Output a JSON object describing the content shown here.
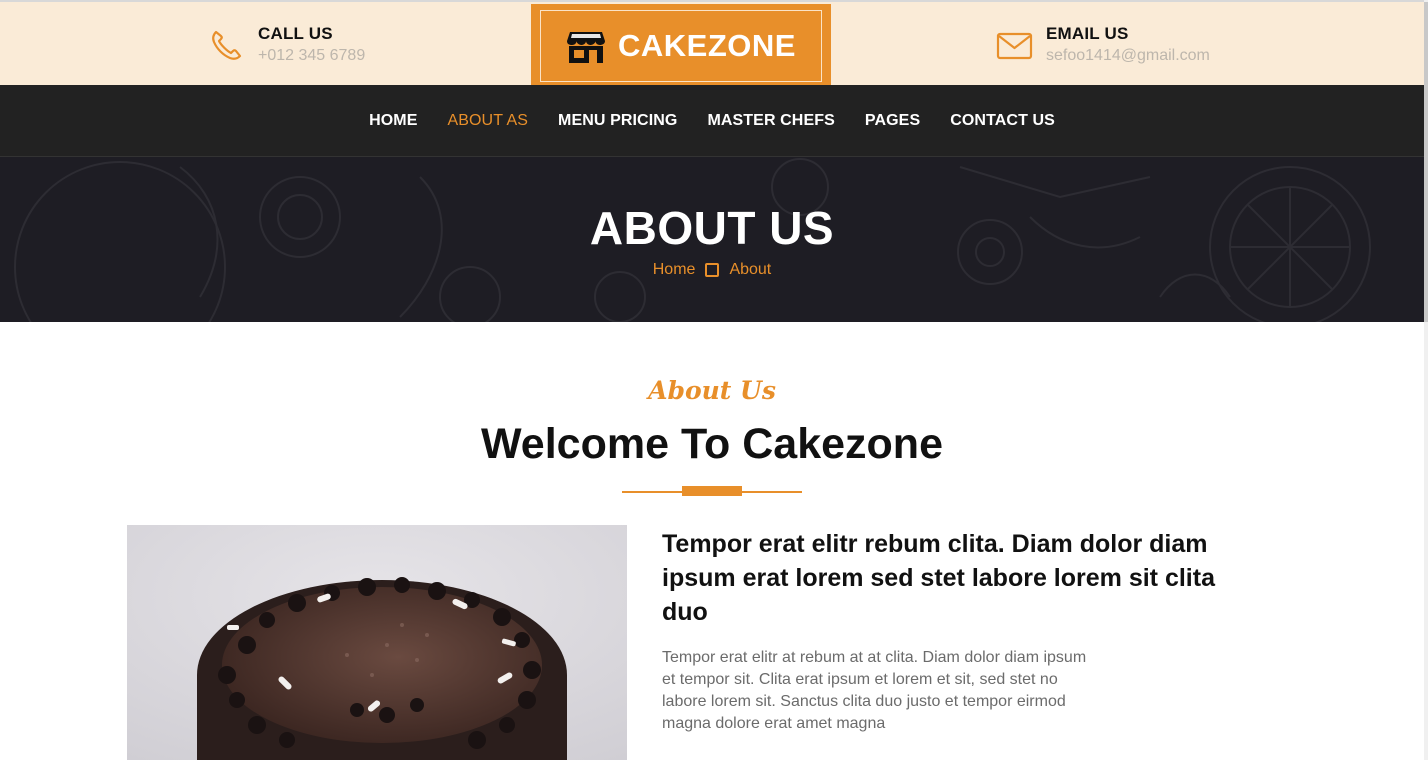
{
  "header": {
    "call": {
      "title": "CALL US",
      "value": "+012 345 6789"
    },
    "email": {
      "title": "EMAIL US",
      "value": "sefoo1414@gmail.com"
    },
    "logo_text": "CAKEZONE"
  },
  "nav": {
    "items": [
      {
        "label": "HOME"
      },
      {
        "label": "ABOUT AS"
      },
      {
        "label": "MENU PRICING"
      },
      {
        "label": "MASTER CHEFS"
      },
      {
        "label": "PAGES"
      },
      {
        "label": "CONTACT US"
      }
    ],
    "active_label": "ABOUT AS"
  },
  "hero": {
    "title": "ABOUT US",
    "breadcrumb": [
      "Home",
      "About"
    ]
  },
  "about": {
    "kicker": "About Us",
    "title": "Welcome To Cakezone",
    "lead": "Tempor erat elitr rebum clita. Diam dolor diam ipsum erat lorem sed stet labore lorem sit clita duo",
    "body": "Tempor erat elitr at rebum at at clita. Diam dolor diam ipsum et tempor sit. Clita erat ipsum et lorem et sit, sed stet no labore lorem sit. Sanctus clita duo justo et tempor eirmod magna dolore erat amet magna"
  },
  "colors": {
    "accent": "#E88F2A",
    "topbar_bg": "#FAEBD7",
    "nav_bg": "#222222",
    "hero_bg": "#1e1d24"
  },
  "icons": {
    "call": "phone-icon",
    "email": "envelope-icon",
    "logo": "shop-icon",
    "breadcrumb_separator": "square-icon"
  }
}
